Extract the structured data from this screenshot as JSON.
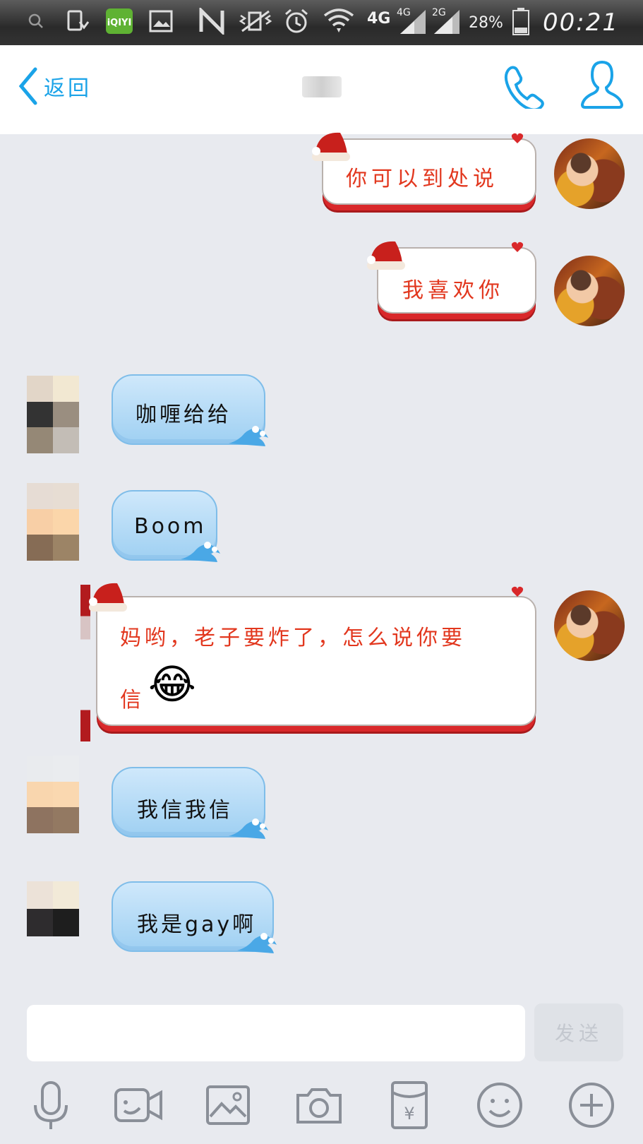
{
  "status_bar": {
    "network_4g": "4G",
    "network_4g_small": "4G",
    "network_2g": "2G",
    "battery": "28%",
    "time": "00:21"
  },
  "header": {
    "back_label": "返回"
  },
  "messages": [
    {
      "side": "me",
      "text": "你可以到处说"
    },
    {
      "side": "me",
      "text": "我喜欢你"
    },
    {
      "side": "other",
      "text": "咖喱给给"
    },
    {
      "side": "other",
      "text": "Boom"
    },
    {
      "side": "me",
      "text": "妈哟，老子要炸了，怎么说你要",
      "text_line2": "信",
      "emoji": "😂"
    },
    {
      "side": "other",
      "text": "我信我信"
    },
    {
      "side": "other",
      "text": "我是gay啊"
    }
  ],
  "composer": {
    "send_label": "发送"
  },
  "toolbar": [
    "microphone-icon",
    "video-icon",
    "image-icon",
    "camera-icon",
    "red-packet-icon",
    "emoji-icon",
    "plus-icon"
  ],
  "colors": {
    "accent": "#1aa3e8",
    "sent_text": "#e2371e",
    "bubble_blue": "#a9d6f5"
  }
}
